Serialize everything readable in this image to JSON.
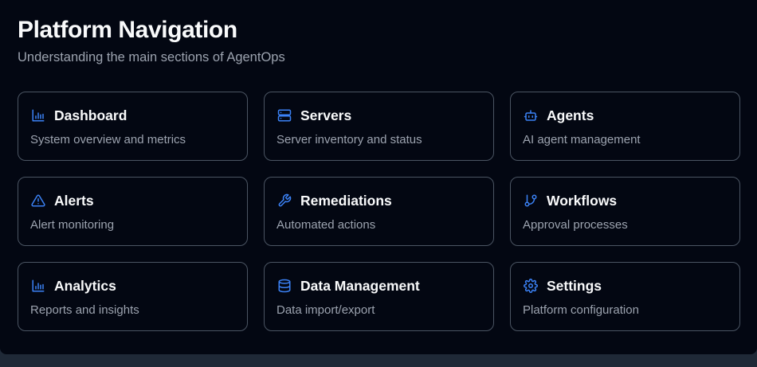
{
  "header": {
    "title": "Platform Navigation",
    "subtitle": "Understanding the main sections of AgentOps"
  },
  "colors": {
    "accent": "#3b82f6",
    "background": "#030712",
    "border": "#4b5563"
  },
  "cards": [
    {
      "icon": "bar-chart-icon",
      "title": "Dashboard",
      "description": "System overview and metrics"
    },
    {
      "icon": "server-icon",
      "title": "Servers",
      "description": "Server inventory and status"
    },
    {
      "icon": "bot-icon",
      "title": "Agents",
      "description": "AI agent management"
    },
    {
      "icon": "warning-triangle-icon",
      "title": "Alerts",
      "description": "Alert monitoring"
    },
    {
      "icon": "wrench-icon",
      "title": "Remediations",
      "description": "Automated actions"
    },
    {
      "icon": "git-branch-icon",
      "title": "Workflows",
      "description": "Approval processes"
    },
    {
      "icon": "bar-chart-icon",
      "title": "Analytics",
      "description": "Reports and insights"
    },
    {
      "icon": "database-icon",
      "title": "Data Management",
      "description": "Data import/export"
    },
    {
      "icon": "gear-icon",
      "title": "Settings",
      "description": "Platform configuration"
    }
  ]
}
